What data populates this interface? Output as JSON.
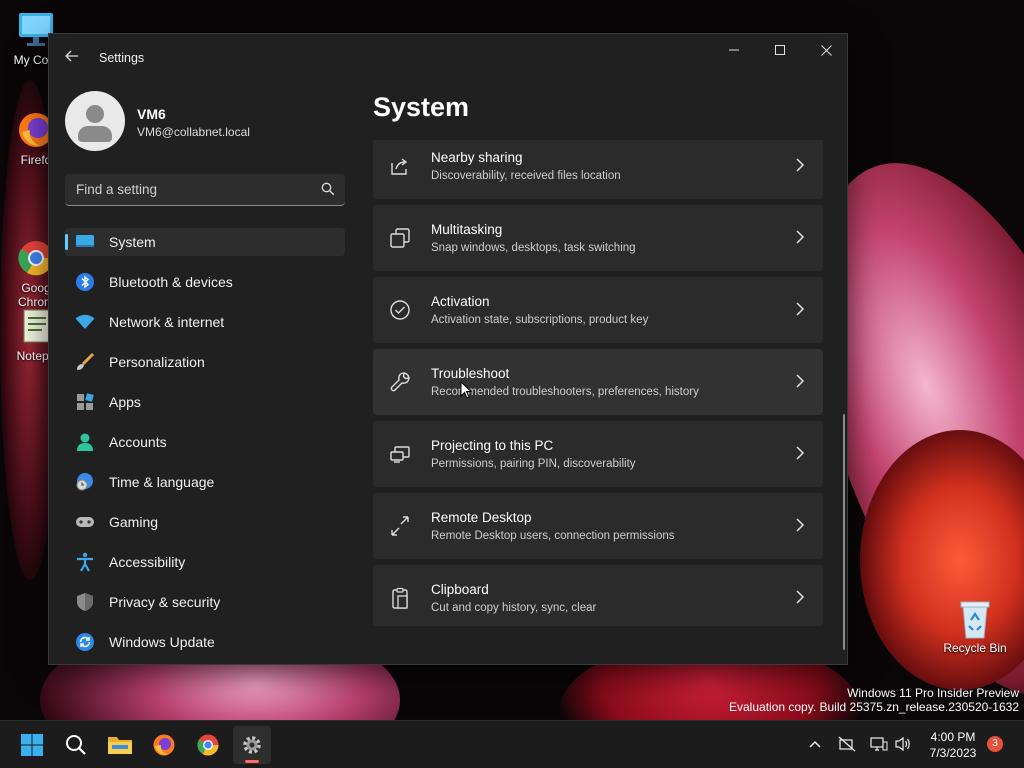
{
  "desktop": {
    "icons": [
      {
        "label": "My Com",
        "icon": "monitor-icon"
      },
      {
        "label": "Firefo",
        "icon": "firefox-icon"
      },
      {
        "label": "Goog\nChrom",
        "icon": "chrome-icon"
      },
      {
        "label": "Notepa",
        "icon": "notepad-icon"
      },
      {
        "label": "Recycle Bin",
        "icon": "recycle-bin-icon"
      }
    ],
    "watermark": {
      "line1": "Windows 11 Pro Insider Preview",
      "line2": "Evaluation copy. Build 25375.zn_release.230520-1632"
    }
  },
  "window": {
    "title": "Settings",
    "controls": [
      "minimize",
      "maximize",
      "close"
    ],
    "profile": {
      "name": "VM6",
      "email": "VM6@collabnet.local"
    },
    "search": {
      "placeholder": "Find a setting"
    },
    "nav": [
      {
        "label": "System",
        "icon": "system-icon",
        "active": true
      },
      {
        "label": "Bluetooth & devices",
        "icon": "bluetooth-icon"
      },
      {
        "label": "Network & internet",
        "icon": "wifi-icon"
      },
      {
        "label": "Personalization",
        "icon": "brush-icon"
      },
      {
        "label": "Apps",
        "icon": "apps-icon"
      },
      {
        "label": "Accounts",
        "icon": "account-icon"
      },
      {
        "label": "Time & language",
        "icon": "globe-clock-icon"
      },
      {
        "label": "Gaming",
        "icon": "controller-icon"
      },
      {
        "label": "Accessibility",
        "icon": "accessibility-icon"
      },
      {
        "label": "Privacy & security",
        "icon": "shield-icon"
      },
      {
        "label": "Windows Update",
        "icon": "update-icon"
      }
    ],
    "page_title": "System",
    "cards": [
      {
        "title": "Nearby sharing",
        "subtitle": "Discoverability, received files location",
        "icon": "share-icon"
      },
      {
        "title": "Multitasking",
        "subtitle": "Snap windows, desktops, task switching",
        "icon": "multitasking-icon"
      },
      {
        "title": "Activation",
        "subtitle": "Activation state, subscriptions, product key",
        "icon": "activation-check-icon"
      },
      {
        "title": "Troubleshoot",
        "subtitle": "Recommended troubleshooters, preferences, history",
        "icon": "wrench-icon"
      },
      {
        "title": "Projecting to this PC",
        "subtitle": "Permissions, pairing PIN, discoverability",
        "icon": "projecting-icon"
      },
      {
        "title": "Remote Desktop",
        "subtitle": "Remote Desktop users, connection permissions",
        "icon": "remote-desktop-icon"
      },
      {
        "title": "Clipboard",
        "subtitle": "Cut and copy history, sync, clear",
        "icon": "clipboard-icon"
      }
    ]
  },
  "taskbar": {
    "apps": [
      "start-icon",
      "search-icon",
      "file-explorer-icon",
      "firefox-icon",
      "chrome-icon",
      "settings-gear-icon"
    ],
    "active_app": "settings-gear-icon",
    "clock": {
      "time": "4:00 PM",
      "date": "7/3/2023"
    },
    "notification_count": "3"
  },
  "colors": {
    "accent": "#60cdff",
    "window_bg": "#202020",
    "card_bg": "#2b2b2b"
  }
}
